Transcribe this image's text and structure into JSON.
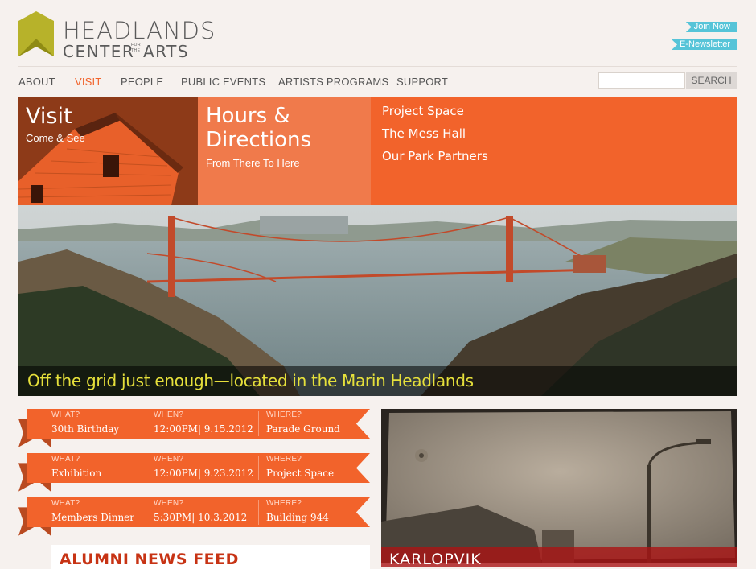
{
  "header": {
    "logo_line1": "HEADLANDS",
    "logo_line2": "CENTER",
    "logo_line2b": "ARTS",
    "logo_small_top": "FOR",
    "logo_small_bottom": "THE",
    "join_label": "Join Now",
    "enews_label": "E-Newsletter"
  },
  "nav": {
    "items": [
      {
        "label": "ABOUT",
        "active": false
      },
      {
        "label": "VISIT",
        "active": true
      },
      {
        "label": "PEOPLE",
        "active": false
      },
      {
        "label": "PUBLIC EVENTS",
        "active": false
      },
      {
        "label": "ARTISTS PROGRAMS",
        "active": false
      },
      {
        "label": "SUPPORT",
        "active": false
      }
    ],
    "search_value": "",
    "search_label": "SEARCH"
  },
  "hero": {
    "visit_title": "Visit",
    "visit_sub": "Come & See",
    "hours_title_1": "Hours &",
    "hours_title_2": "Directions",
    "hours_sub": "From There To Here",
    "links": [
      "Project Space",
      "The Mess Hall",
      "Our Park Partners"
    ],
    "caption": "Off the grid just enough—located in the Marin Headlands"
  },
  "events": {
    "what_label": "WHAT?",
    "when_label": "WHEN?",
    "where_label": "WHERE?",
    "items": [
      {
        "what": "30th Birthday",
        "when": "12:00PM| 9.15.2012",
        "where": "Parade Ground"
      },
      {
        "what": "Exhibition",
        "when": "12:00PM| 9.23.2012",
        "where": "Project Space"
      },
      {
        "what": "Members Dinner",
        "when": "5:30PM| 10.3.2012",
        "where": "Building 944"
      }
    ]
  },
  "alumni": {
    "title": "ALUMNI NEWS FEED"
  },
  "feature": {
    "label": "KARLOPVIK"
  },
  "colors": {
    "accent": "#f2632b",
    "dark_orange": "#8d3a18",
    "logo_green": "#b7b22a",
    "join_blue": "#56c4d8"
  }
}
